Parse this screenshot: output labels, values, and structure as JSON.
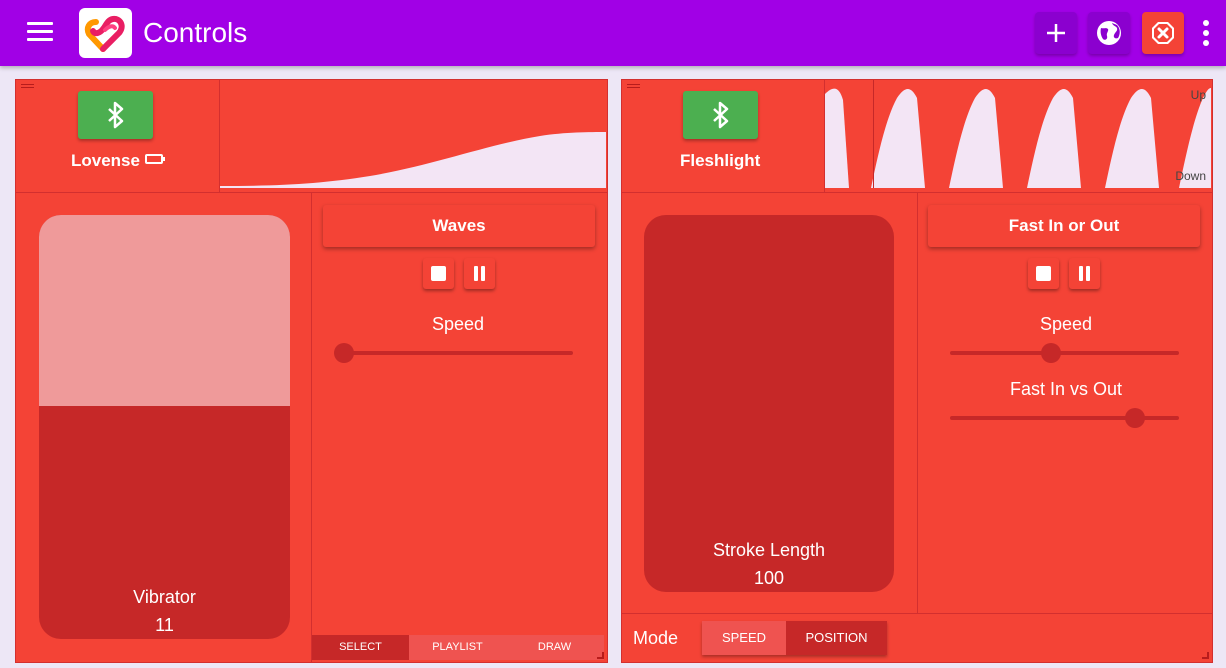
{
  "appbar": {
    "title": "Controls",
    "actions": [
      {
        "icon": "add-icon"
      },
      {
        "icon": "globe-icon"
      },
      {
        "icon": "emergency-stop-icon"
      },
      {
        "icon": "more-vert-icon"
      }
    ],
    "color": "#a100e6"
  },
  "devices": [
    {
      "name": "Lovense",
      "connection_icon": "bluetooth-icon",
      "battery_icon": "battery-icon",
      "output": {
        "label": "Vibrator",
        "value": "11",
        "fill_fraction": 0.55
      },
      "pattern": {
        "name": "Waves",
        "controls": {
          "stop_icon": "stop-icon",
          "pause_icon": "pause-icon"
        },
        "sliders": [
          {
            "label": "Speed",
            "fraction": 0.0
          }
        ]
      },
      "tabs": [
        {
          "label": "SELECT",
          "active": true
        },
        {
          "label": "PLAYLIST",
          "active": false
        },
        {
          "label": "DRAW",
          "active": false
        }
      ]
    },
    {
      "name": "Fleshlight",
      "connection_icon": "bluetooth-icon",
      "graph_labels": {
        "top": "Up",
        "bottom": "Down"
      },
      "output": {
        "label": "Stroke Length",
        "value": "100",
        "fill_fraction": 1.0
      },
      "pattern": {
        "name": "Fast In or Out",
        "controls": {
          "stop_icon": "stop-icon",
          "pause_icon": "pause-icon"
        },
        "sliders": [
          {
            "label": "Speed",
            "fraction": 0.44
          },
          {
            "label": "Fast In vs Out",
            "fraction": 0.81
          }
        ]
      },
      "mode": {
        "label": "Mode",
        "options": [
          {
            "label": "SPEED",
            "active": false
          },
          {
            "label": "POSITION",
            "active": true
          }
        ]
      }
    }
  ],
  "colors": {
    "panel": "#f44336",
    "dark": "#c62828",
    "light_fill": "#ef9a9a",
    "graph_bg": "#f3e5f5",
    "bluetooth_button": "#4caf50"
  }
}
